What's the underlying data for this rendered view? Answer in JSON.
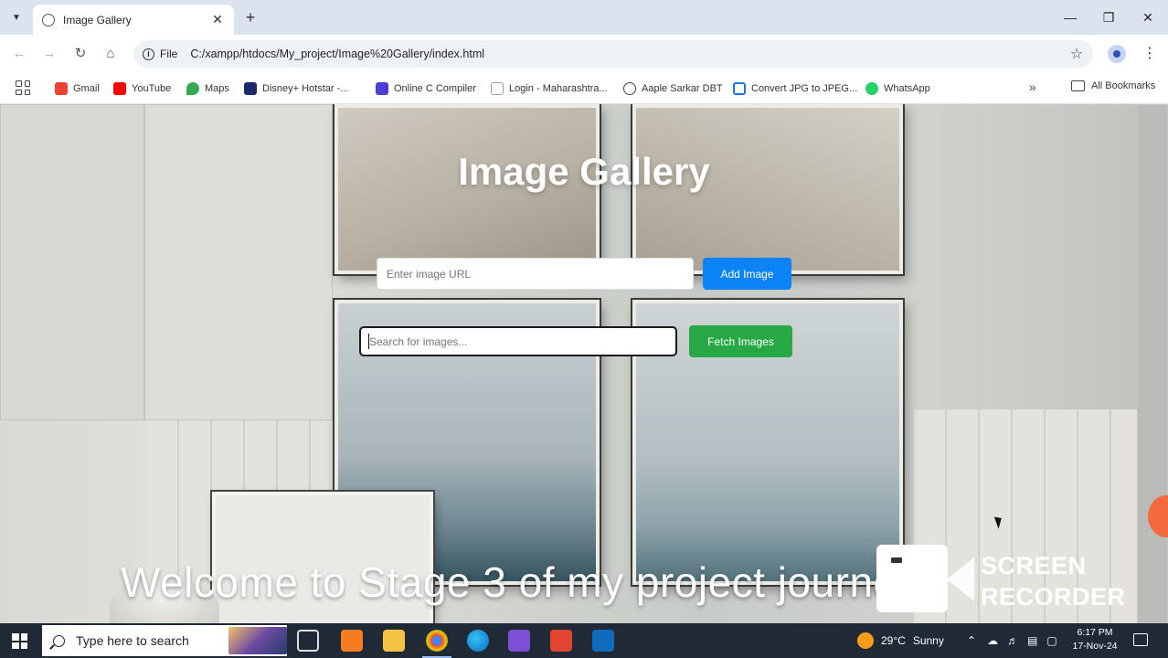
{
  "browser": {
    "tab_title": "Image Gallery",
    "new_tab": "+",
    "tab_close": "✕",
    "site_info_label": "File",
    "url": "C:/xampp/htdocs/My_project/Image%20Gallery/index.html",
    "bookmarks": [
      {
        "label": "Gmail",
        "icon": "gmail-icon",
        "color": "#ea4335"
      },
      {
        "label": "YouTube",
        "icon": "youtube-icon",
        "color": "#ff0000"
      },
      {
        "label": "Maps",
        "icon": "maps-icon",
        "color": "#34a853"
      },
      {
        "label": "Disney+ Hotstar -...",
        "icon": "hotstar-icon",
        "color": "#1b2a6b"
      },
      {
        "label": "Online C Compiler",
        "icon": "compiler-icon",
        "color": "#4b3fd6"
      },
      {
        "label": "Login - Maharashtra...",
        "icon": "page-icon",
        "color": "#9aa0a6"
      },
      {
        "label": "Aaple Sarkar DBT",
        "icon": "globe-icon",
        "color": "#444444"
      },
      {
        "label": "Convert JPG to JPEG...",
        "icon": "convert-icon",
        "color": "#1a73e8"
      },
      {
        "label": "WhatsApp",
        "icon": "whatsapp-icon",
        "color": "#25d366"
      }
    ],
    "all_bookmarks": "All Bookmarks"
  },
  "page": {
    "title": "Image Gallery",
    "url_input_placeholder": "Enter image URL",
    "add_button": "Add Image",
    "search_placeholder": "Search for images...",
    "fetch_button": "Fetch Images",
    "accent_add": "#0d84f5",
    "accent_fetch": "#27a844"
  },
  "overlay": {
    "caption": "Welcome to Stage 3 of my project journey!",
    "recorder_line1": "SCREEN",
    "recorder_line2": "RECORDER"
  },
  "taskbar": {
    "search_text": "Type here to search",
    "weather_temp": "29°C",
    "weather_text": "Sunny",
    "time": "6:17 PM",
    "date": "17-Nov-24"
  }
}
